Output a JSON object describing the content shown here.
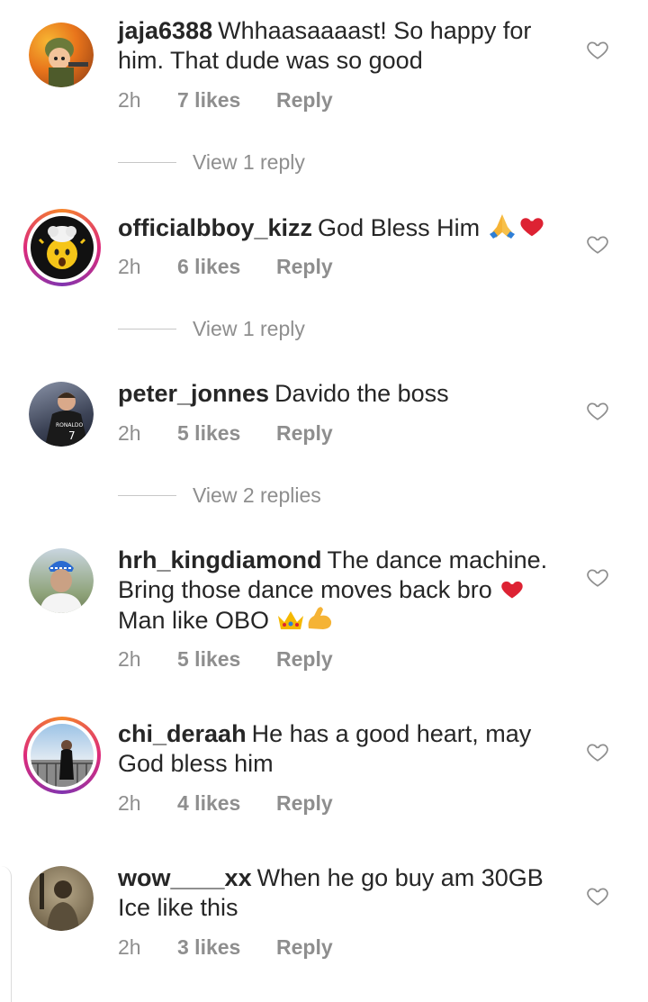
{
  "comments": [
    {
      "username": "jaja6388",
      "text": "Whhaasaaaast! So happy for him. That dude was so good",
      "time": "2h",
      "likes": "7 likes",
      "reply": "Reply",
      "view_replies": "View 1 reply",
      "avatar": "cartoon-soldier-avatar"
    },
    {
      "username": "officialbboy_kizz",
      "text": "God Bless Him",
      "time": "2h",
      "likes": "6 likes",
      "reply": "Reply",
      "view_replies": "View 1 reply",
      "avatar": "mind-blown-emoji-avatar"
    },
    {
      "username": "peter_jonnes",
      "text": "Davido the boss",
      "time": "2h",
      "likes": "5 likes",
      "reply": "Reply",
      "view_replies": "View 2 replies",
      "avatar": "footballer-avatar"
    },
    {
      "username": "hrh_kingdiamond",
      "text": "The dance machine. Bring those dance moves back bro",
      "text2": "Man like OBO",
      "time": "2h",
      "likes": "5 likes",
      "reply": "Reply",
      "avatar": "man-in-cap-avatar"
    },
    {
      "username": "chi_deraah",
      "text": "He has a good heart, may God bless him",
      "time": "2h",
      "likes": "4 likes",
      "reply": "Reply",
      "avatar": "woman-on-balcony-avatar"
    },
    {
      "username": "wow____xx",
      "text": "When he go buy am 30GB Ice like this",
      "time": "2h",
      "likes": "3 likes",
      "reply": "Reply",
      "avatar": "vintage-photo-avatar"
    }
  ],
  "colors": {
    "heart_red": "#ed2b3a",
    "muted": "#8e8e8e",
    "text": "#262626"
  }
}
